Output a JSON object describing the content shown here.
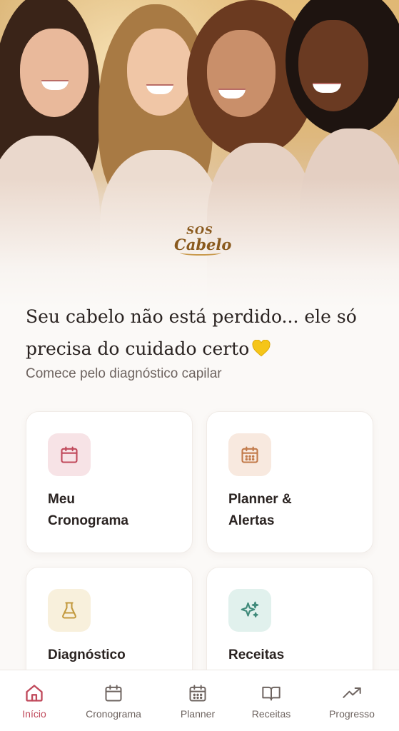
{
  "hero": {
    "brand_line1": "SOS",
    "brand_line2": "Cabelo"
  },
  "headline": {
    "line1": "Seu cabelo não está perdido... ele só",
    "line2": "precisa do cuidado certo",
    "heart_icon": "yellow-heart-icon"
  },
  "subheadline": "Comece pelo diagnóstico capilar",
  "cards": [
    {
      "title_line1": "Meu",
      "title_line2": "Cronograma",
      "icon": "calendar-icon",
      "icon_color": "#c0495b",
      "icon_bg": "#f7e3e6"
    },
    {
      "title_line1": "Planner &",
      "title_line2": "Alertas",
      "icon": "calendar-grid-icon",
      "icon_color": "#c27a4a",
      "icon_bg": "#f8e9df"
    },
    {
      "title_line1": "Diagnóstico",
      "title_line2": "",
      "icon": "flask-icon",
      "icon_color": "#c39a3f",
      "icon_bg": "#f8f0dc"
    },
    {
      "title_line1": "Receitas",
      "title_line2": "",
      "icon": "sparkles-icon",
      "icon_color": "#3f8a7a",
      "icon_bg": "#e1f1ed"
    }
  ],
  "nav": {
    "active_color": "#c0495b",
    "items": [
      {
        "label": "Início",
        "icon": "home-icon",
        "active": true
      },
      {
        "label": "Cronograma",
        "icon": "calendar-icon",
        "active": false
      },
      {
        "label": "Planner",
        "icon": "calendar-grid-icon",
        "active": false
      },
      {
        "label": "Receitas",
        "icon": "book-open-icon",
        "active": false
      },
      {
        "label": "Progresso",
        "icon": "trending-up-icon",
        "active": false
      }
    ]
  }
}
